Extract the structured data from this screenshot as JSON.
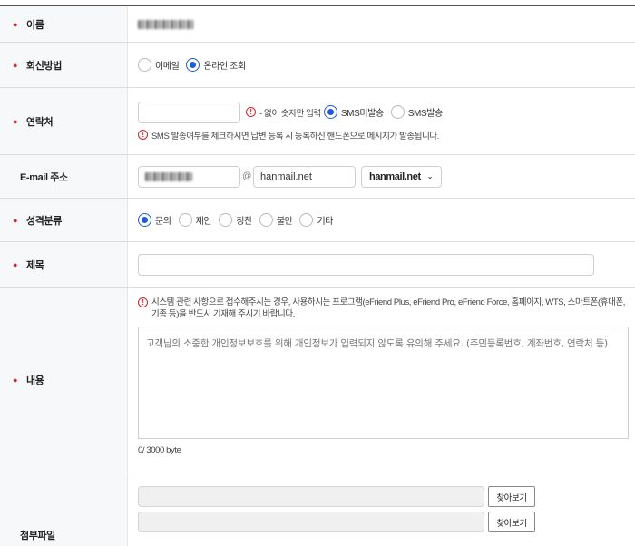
{
  "form": {
    "name": {
      "label": "이름"
    },
    "reply_method": {
      "label": "회신방법",
      "options": [
        {
          "label": "이메일",
          "checked": false
        },
        {
          "label": "온라인 조회",
          "checked": true
        }
      ]
    },
    "contact": {
      "label": "연락처",
      "input_value": "",
      "hint": "- 없이 숫자만 입력",
      "sms_options": [
        {
          "label": "SMS미발송",
          "checked": true
        },
        {
          "label": "SMS발송",
          "checked": false
        }
      ],
      "note": "SMS 발송여부를 체크하시면 답변 등록 시 등록하신 핸드폰으로 메시지가 발송됩니다."
    },
    "email": {
      "label": "E-mail 주소",
      "domain_value": "hanmail.net",
      "domain_select": "hanmail.net"
    },
    "category": {
      "label": "성격분류",
      "options": [
        {
          "label": "문의",
          "checked": true
        },
        {
          "label": "제안",
          "checked": false
        },
        {
          "label": "칭찬",
          "checked": false
        },
        {
          "label": "불만",
          "checked": false
        },
        {
          "label": "기타",
          "checked": false
        }
      ]
    },
    "subject": {
      "label": "제목",
      "input_value": ""
    },
    "content": {
      "label": "내용",
      "notice": "시스템 관련 사항으로 접수해주시는 경우, 사용하시는 프로그램(eFriend Plus, eFriend Pro, eFriend Force, 홈페이지, WTS, 스마트폰(휴대폰, 기종 등)을 반드시 기재해 주시기 바랍니다.",
      "placeholder": "고객님의 소중한 개인정보보호를 위해 개인정보가 입력되지 않도록 유의해 주세요. (주민등록번호, 계좌번호, 연락처 등)",
      "counter": "0/ 3000 byte"
    },
    "attachment": {
      "label": "첨부파일",
      "browse_label": "찾아보기"
    }
  },
  "colors": {
    "accent": "#1f5bd8",
    "required": "#d2232a",
    "label_bg": "#f7f8fa"
  },
  "icons": {
    "warning": "exclamation-circle-icon",
    "dropdown": "chevron-down-icon",
    "required": "required-dot-icon"
  }
}
